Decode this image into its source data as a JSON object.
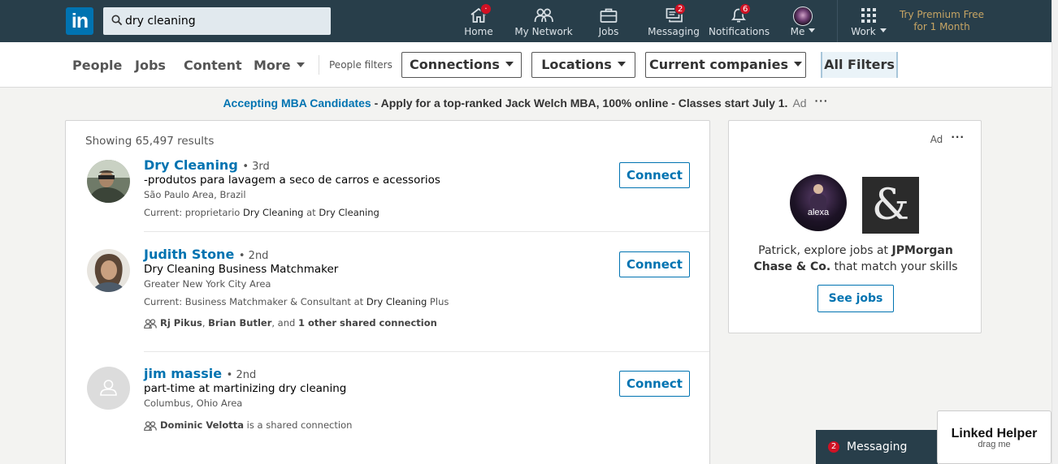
{
  "header": {
    "logo": "in",
    "search_value": "dry cleaning",
    "nav": {
      "home": "Home",
      "network": "My Network",
      "jobs": "Jobs",
      "messaging": "Messaging",
      "notifications": "Notifications",
      "me": "Me",
      "work": "Work"
    },
    "badges": {
      "home": "·",
      "messaging": "2",
      "notifications": "6"
    },
    "premium": [
      "Try Premium Free",
      "for 1 Month"
    ]
  },
  "filters": {
    "tabs": {
      "people": "People",
      "jobs": "Jobs",
      "content": "Content",
      "more": "More"
    },
    "people_filters_label": "People filters",
    "connections": "Connections",
    "locations": "Locations",
    "current_companies": "Current companies",
    "all_filters": "All Filters"
  },
  "ad_banner": {
    "link": "Accepting MBA Candidates",
    "text": " - Apply for a top-ranked Jack Welch MBA, 100% online - Classes start July 1.",
    "tag": "Ad",
    "more": "···"
  },
  "results": {
    "count_text": "Showing 65,497 results",
    "connect_label": "Connect",
    "items": [
      {
        "name": "Dry Cleaning",
        "degree": "• 3rd",
        "headline": "-produtos para lavagem a seco de carros e acessorios",
        "location": "São Paulo Area, Brazil",
        "current_prefix": "Current: proprietario ",
        "current_role": "Dry Cleaning",
        "current_mid": " at ",
        "current_company": "Dry Cleaning"
      },
      {
        "name": "Judith Stone",
        "degree": "• 2nd",
        "headline": "Dry Cleaning Business Matchmaker",
        "location": "Greater New York City Area",
        "current_prefix": "Current: Business Matchmaker & Consultant at ",
        "current_role": "Dry Cleaning",
        "current_mid": " Plus",
        "shared_a": "Rj Pikus",
        "shared_sep": ", ",
        "shared_b": "Brian Butler",
        "shared_and": ", and ",
        "shared_c": "1 other shared connection"
      },
      {
        "name": "jim massie",
        "degree": "• 2nd",
        "headline": "part-time at martinizing dry cleaning",
        "location": "Columbus, Ohio Area",
        "shared_a": "Dominic Velotta",
        "shared_rest": " is a shared connection"
      }
    ]
  },
  "side_ad": {
    "tag": "Ad",
    "more": "···",
    "logo1_text": "alexa",
    "logo2_text": "&",
    "text_prefix": "Patrick, explore jobs at ",
    "company": "JPMorgan Chase & Co.",
    "text_suffix": " that match your skills",
    "button": "See jobs"
  },
  "messaging_bar": {
    "badge": "2",
    "label": "Messaging"
  },
  "linked_helper": {
    "title": "Linked Helper",
    "sub": "drag me"
  },
  "colors": {
    "brand": "#0073b1",
    "nav_bg": "#283e4a",
    "badge": "#d11124",
    "premium": "#c7a564"
  }
}
